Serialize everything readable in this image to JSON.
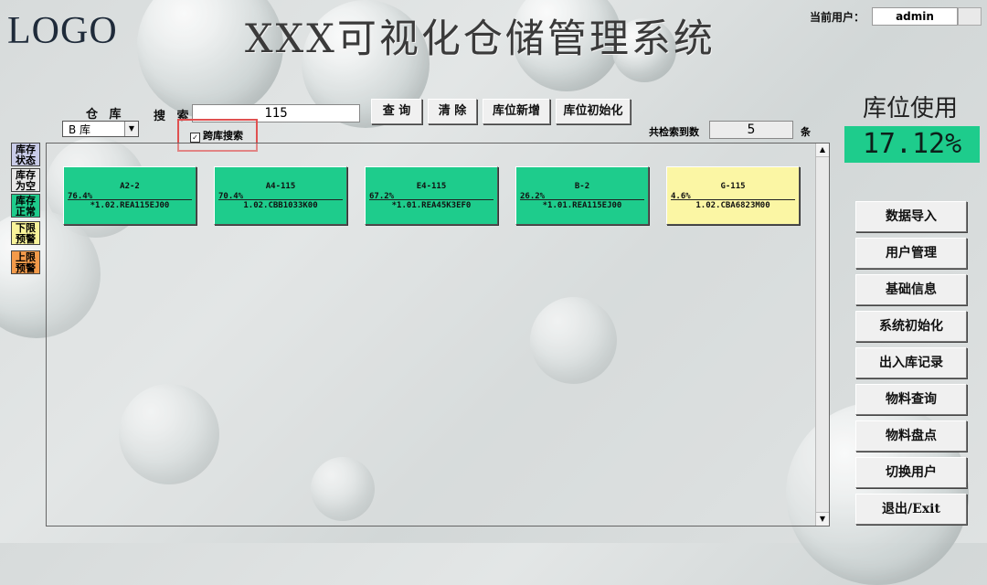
{
  "header": {
    "logo": "LOGO",
    "title": "XXX可视化仓储管理系统",
    "user_label": "当前用户：",
    "user_value": "admin"
  },
  "filters": {
    "warehouse_label": "仓 库",
    "warehouse_value": "B 库",
    "search_label": "搜 索",
    "search_value": "115",
    "cross_label": "跨库搜索",
    "cross_checked": "✓"
  },
  "toolbar": {
    "query": "查 询",
    "clear": "清 除",
    "add_location": "库位新增",
    "init_location": "库位初始化"
  },
  "result": {
    "label": "共检索到数",
    "count": "5",
    "unit": "条"
  },
  "usage": {
    "title": "库位使用",
    "value": "17.12%"
  },
  "legend": [
    {
      "label": "库存状态",
      "color": "#c8cbe8"
    },
    {
      "label": "库存为空",
      "color": "#e8e8e8"
    },
    {
      "label": "库存正常",
      "color": "#1ecc8c"
    },
    {
      "label": "下限预警",
      "color": "#f8f39a"
    },
    {
      "label": "上限预警",
      "color": "#f39a4a"
    }
  ],
  "tiles": [
    {
      "name": "A2-2",
      "pct": "76.4%",
      "code": "*1.02.REA115EJ00",
      "color": "#1ecc8c"
    },
    {
      "name": "A4-115",
      "pct": "70.4%",
      "code": "1.02.CBB1033K00",
      "color": "#1ecc8c"
    },
    {
      "name": "E4-115",
      "pct": "67.2%",
      "code": "*1.01.REA45K3EF0",
      "color": "#1ecc8c"
    },
    {
      "name": "B-2",
      "pct": "26.2%",
      "code": "*1.01.REA115EJ00",
      "color": "#1ecc8c"
    },
    {
      "name": "G-115",
      "pct": "4.6%",
      "code": "1.02.CBA6823M00",
      "color": "#fbf6a4"
    }
  ],
  "sidebar": [
    {
      "label": "数据导入"
    },
    {
      "label": "用户管理"
    },
    {
      "label": "基础信息"
    },
    {
      "label": "系统初始化"
    },
    {
      "label": "出入库记录"
    },
    {
      "label": "物料查询"
    },
    {
      "label": "物料盘点"
    },
    {
      "label": "切换用户"
    },
    {
      "label": "退出/Exit"
    }
  ]
}
